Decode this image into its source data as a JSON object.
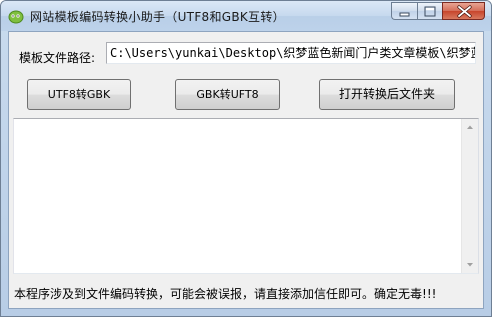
{
  "window": {
    "title": "网站模板编码转换小助手（UTF8和GBK互转）"
  },
  "form": {
    "path_label": "模板文件路径:",
    "path_value": "C:\\Users\\yunkai\\Desktop\\织梦蓝色新闻门户类文章模板\\织梦蓝色新"
  },
  "buttons": {
    "utf8_to_gbk": "UTF8转GBK",
    "gbk_to_utf8": "GBK转UFT8",
    "open_folder": "打开转换后文件夹"
  },
  "log": {
    "content": ""
  },
  "status": {
    "message": "本程序涉及到文件编码转换，可能会被误报，请直接添加信任即可。确定无毒!!!"
  },
  "icons": {
    "app": "app-icon",
    "minimize": "minimize-icon",
    "maximize": "maximize-icon",
    "close": "close-icon",
    "scroll_up": "arrow-up-icon",
    "scroll_down": "arrow-down-icon"
  },
  "colors": {
    "titlebar": "#c6d9ee",
    "close_button": "#c7452c",
    "client_bg": "#f0f0f0"
  }
}
